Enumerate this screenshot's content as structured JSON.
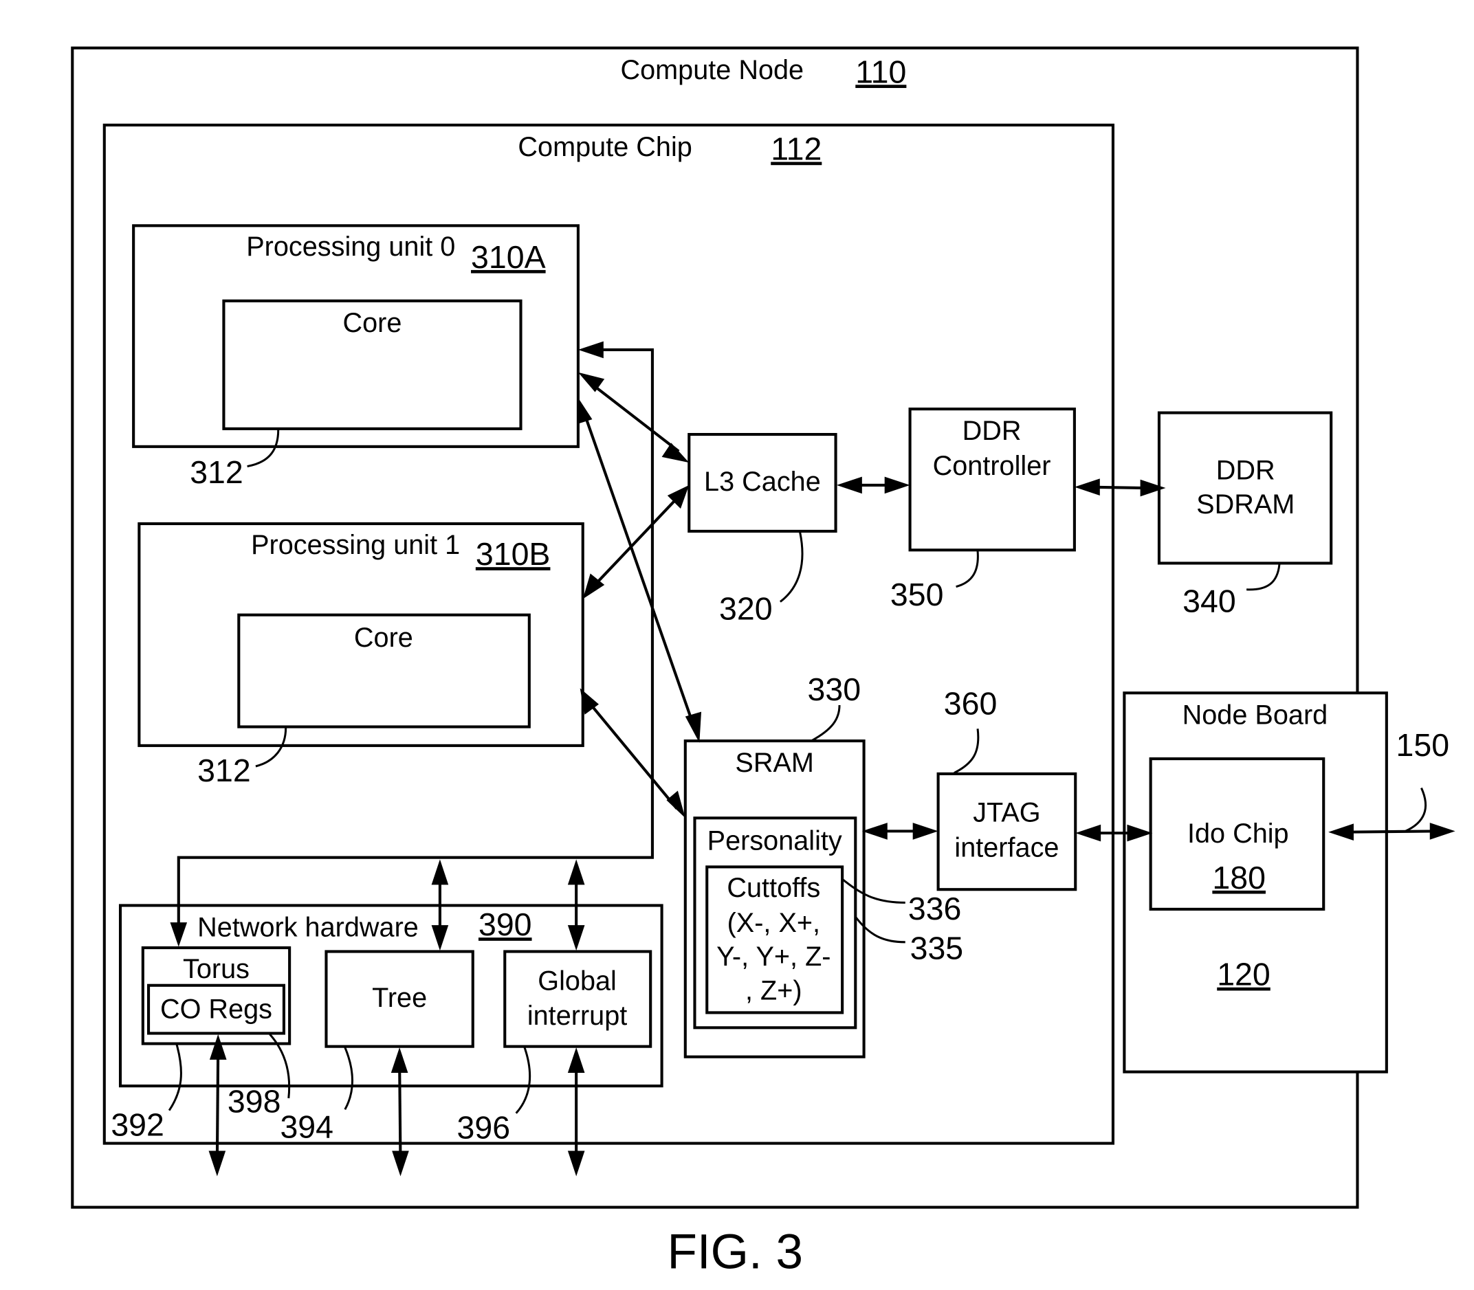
{
  "figure": {
    "caption": "FIG. 3"
  },
  "compute_node": {
    "title": "Compute Node",
    "ref": "110"
  },
  "compute_chip": {
    "title": "Compute Chip",
    "ref": "112"
  },
  "processing_units": [
    {
      "title": "Processing unit 0",
      "ref": "310A",
      "core_label": "Core",
      "core_ref": "312"
    },
    {
      "title": "Processing unit 1",
      "ref": "310B",
      "core_label": "Core",
      "core_ref": "312"
    }
  ],
  "l3_cache": {
    "label": "L3 Cache",
    "ref": "320"
  },
  "ddr_controller": {
    "line1": "DDR",
    "line2": "Controller",
    "ref": "350"
  },
  "ddr_sdram": {
    "line1": "DDR",
    "line2": "SDRAM",
    "ref": "340"
  },
  "sram": {
    "label": "SRAM",
    "ref": "330",
    "personality": {
      "label": "Personality",
      "ref": "335"
    },
    "cutoffs": {
      "lines": [
        "Cuttoffs",
        "(X-, X+,",
        "Y-, Y+, Z-",
        ", Z+)"
      ],
      "ref": "336"
    }
  },
  "jtag": {
    "line1": "JTAG",
    "line2": "interface",
    "ref": "360"
  },
  "node_board": {
    "title": "Node Board",
    "ref": "120",
    "ido_chip": {
      "label": "Ido Chip",
      "ref": "180"
    },
    "link_ref": "150"
  },
  "network_hardware": {
    "title": "Network hardware",
    "ref": "390",
    "torus": {
      "label": "Torus",
      "ref": "392",
      "co_regs": {
        "label": "CO Regs",
        "ref": "398"
      }
    },
    "tree": {
      "label": "Tree",
      "ref": "394"
    },
    "global_interrupt": {
      "line1": "Global",
      "line2": "interrupt",
      "ref": "396"
    }
  }
}
